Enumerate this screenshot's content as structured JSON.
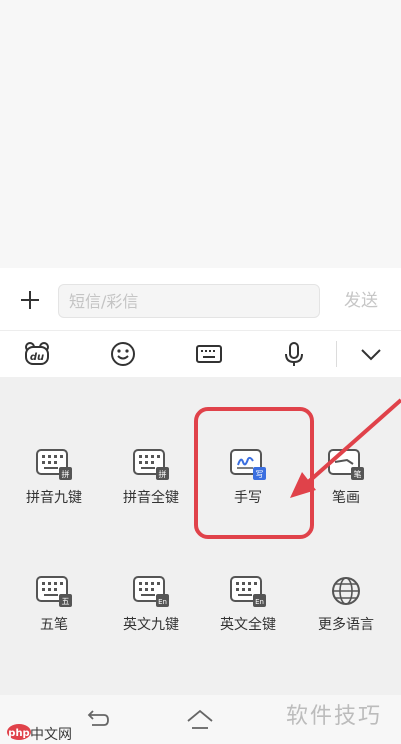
{
  "compose": {
    "placeholder": "短信/彩信",
    "send_label": "发送"
  },
  "toolbar": {
    "icons": [
      "du-bear-icon",
      "emoji-icon",
      "keyboard-icon",
      "microphone-icon",
      "chevron-down-icon"
    ]
  },
  "input_methods": [
    {
      "label": "拼音九键",
      "badge": "拼"
    },
    {
      "label": "拼音全键",
      "badge": "拼"
    },
    {
      "label": "手写",
      "badge": "写"
    },
    {
      "label": "笔画",
      "badge": "笔"
    },
    {
      "label": "五笔",
      "badge": "五"
    },
    {
      "label": "英文九键",
      "badge": "En"
    },
    {
      "label": "英文全键",
      "badge": "En"
    },
    {
      "label": "更多语言",
      "badge": ""
    }
  ],
  "watermarks": {
    "left_brand": "php",
    "left": "中文网",
    "right": "软件技巧"
  },
  "colors": {
    "highlight": "#e0424a",
    "handwrite_accent": "#3b6fe0",
    "icon_gray": "#555555"
  }
}
